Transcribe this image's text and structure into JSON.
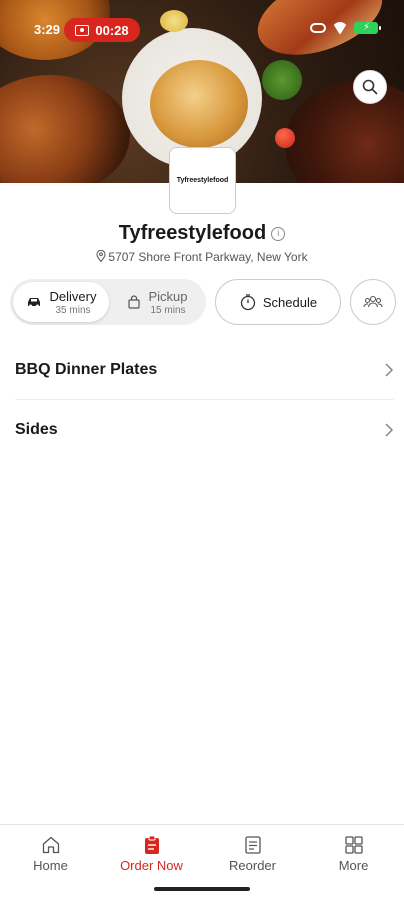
{
  "status_bar": {
    "time": "3:29",
    "recording": "00:28"
  },
  "restaurant": {
    "logo_text": "Tyfreestylefood",
    "name": "Tyfreestylefood",
    "address": "5707 Shore Front Parkway, New York"
  },
  "order_modes": {
    "delivery": {
      "label": "Delivery",
      "time": "35 mins",
      "selected": true
    },
    "pickup": {
      "label": "Pickup",
      "time": "15 mins",
      "selected": false
    },
    "schedule_label": "Schedule"
  },
  "categories": [
    {
      "label": "BBQ Dinner Plates"
    },
    {
      "label": "Sides"
    }
  ],
  "bottom_nav": [
    {
      "label": "Home",
      "icon": "home-icon"
    },
    {
      "label": "Order Now",
      "icon": "order-icon",
      "active": true
    },
    {
      "label": "Reorder",
      "icon": "reorder-icon"
    },
    {
      "label": "More",
      "icon": "grid-icon"
    }
  ],
  "colors": {
    "accent": "#d8261f",
    "battery": "#2fd158"
  }
}
